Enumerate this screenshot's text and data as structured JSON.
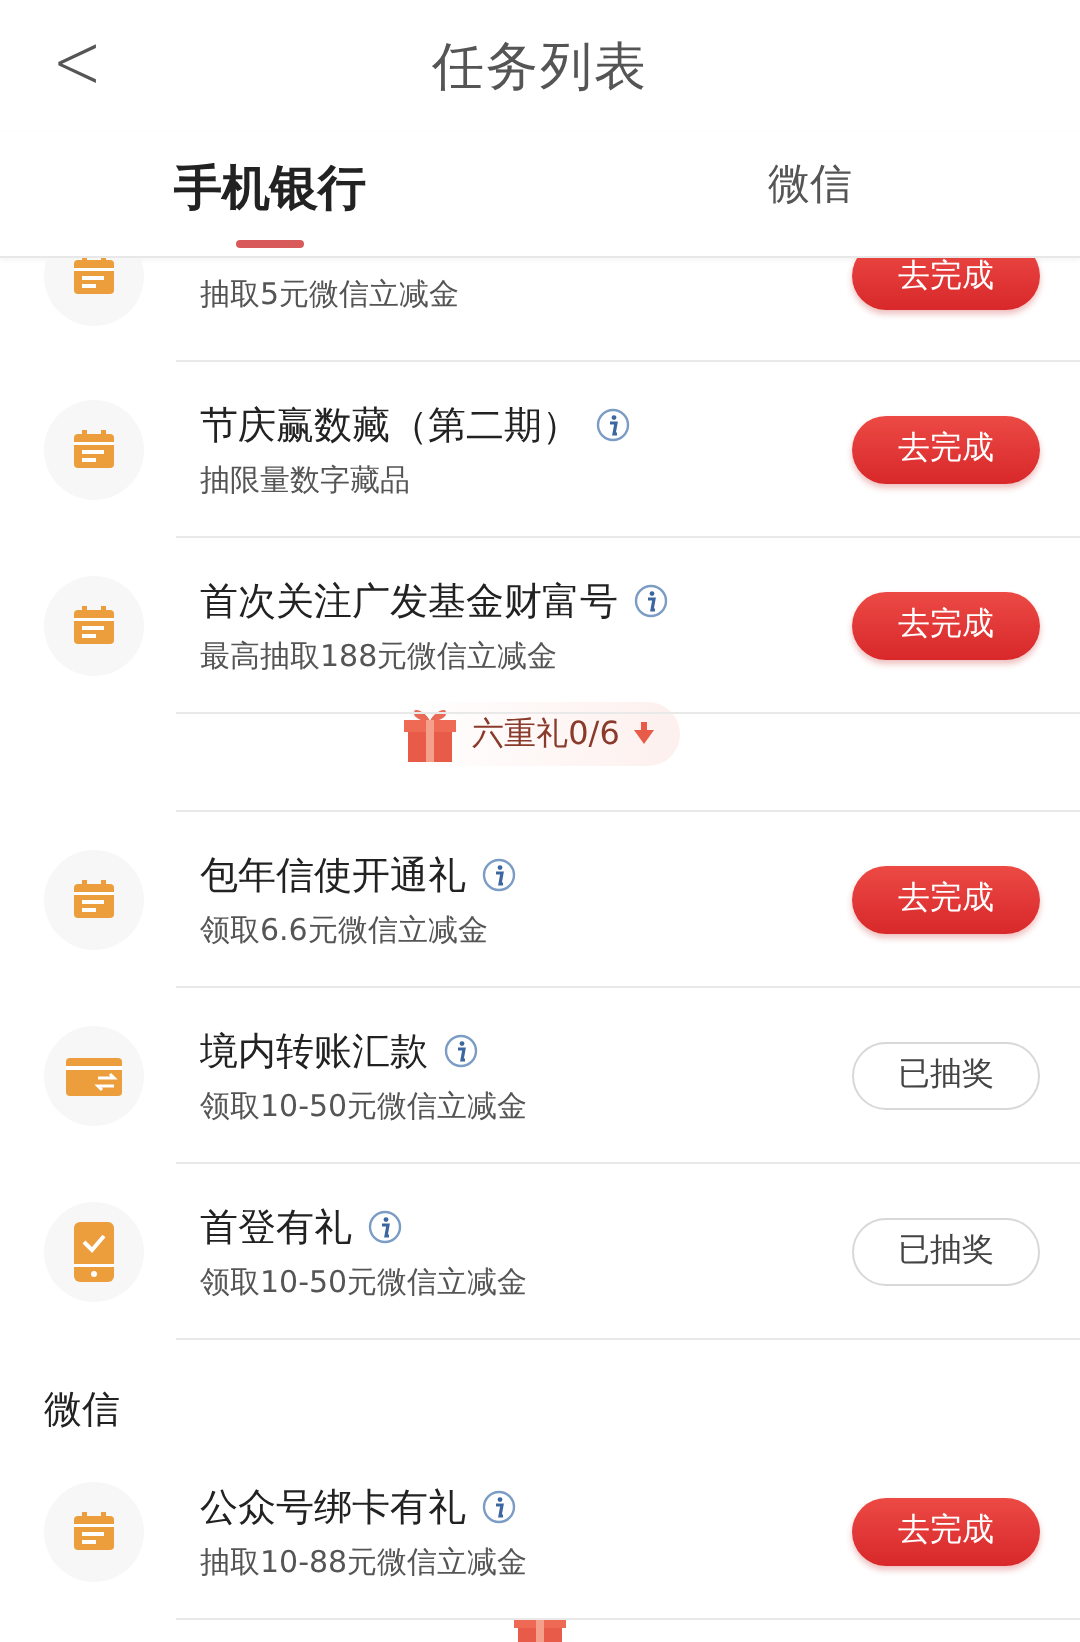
{
  "header": {
    "back": "<",
    "title": "任务列表"
  },
  "tabs": [
    {
      "label": "手机银行",
      "selected": true
    },
    {
      "label": "微信",
      "selected": false
    }
  ],
  "sections": [
    {
      "tasks": [
        {
          "kind": "calendar",
          "subtitle": "抽取5元微信立减金",
          "action": {
            "label": "去完成",
            "done": false
          }
        },
        {
          "kind": "calendar",
          "title": "节庆赢数藏（第二期）",
          "subtitle": "抽限量数字藏品",
          "action": {
            "label": "去完成",
            "done": false
          }
        },
        {
          "kind": "calendar",
          "title": "首次关注广发基金财富号",
          "subtitle": "最高抽取188元微信立减金",
          "action": {
            "label": "去完成",
            "done": false
          },
          "bonus": "六重礼0/6"
        },
        {
          "kind": "calendar",
          "title": "包年信使开通礼",
          "subtitle": "领取6.6元微信立减金",
          "action": {
            "label": "去完成",
            "done": false
          }
        },
        {
          "kind": "transfer",
          "title": "境内转账汇款",
          "subtitle": "领取10-50元微信立减金",
          "action": {
            "label": "已抽奖",
            "done": true
          }
        },
        {
          "kind": "phone",
          "title": "首登有礼",
          "subtitle": "领取10-50元微信立减金",
          "action": {
            "label": "已抽奖",
            "done": true
          }
        }
      ]
    },
    {
      "heading": "微信",
      "tasks": [
        {
          "kind": "calendar",
          "title": "公众号绑卡有礼",
          "subtitle": "抽取10-88元微信立减金",
          "action": {
            "label": "去完成",
            "done": false
          },
          "bonus_cut": true
        }
      ]
    }
  ]
}
